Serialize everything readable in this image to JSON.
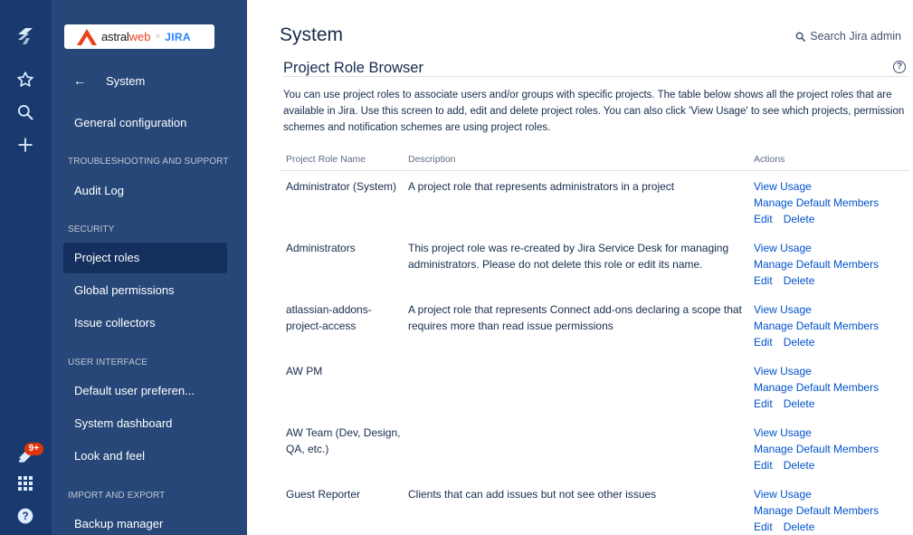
{
  "brand": {
    "part1": "astral",
    "part2": "web",
    "separator": "×",
    "product": "JIRA"
  },
  "sidebar": {
    "back_label": "System",
    "items": [
      {
        "label": "General configuration",
        "active": false
      },
      {
        "section": "TROUBLESHOOTING AND SUPPORT"
      },
      {
        "label": "Audit Log",
        "active": false
      },
      {
        "section": "SECURITY"
      },
      {
        "label": "Project roles",
        "active": true
      },
      {
        "label": "Global permissions",
        "active": false
      },
      {
        "label": "Issue collectors",
        "active": false
      },
      {
        "section": "USER INTERFACE"
      },
      {
        "label": "Default user preferen...",
        "active": false
      },
      {
        "label": "System dashboard",
        "active": false
      },
      {
        "label": "Look and feel",
        "active": false
      },
      {
        "section": "IMPORT AND EXPORT"
      },
      {
        "label": "Backup manager",
        "active": false
      }
    ]
  },
  "rail": {
    "notifications_badge": "9+"
  },
  "header": {
    "title": "System",
    "search_label": "Search Jira admin"
  },
  "content": {
    "section_title": "Project Role Browser",
    "help_label": "?",
    "intro": "You can use project roles to associate users and/or groups with specific projects. The table below shows all the project roles that are available in Jira. Use this screen to add, edit and delete project roles. You can also click 'View Usage' to see which projects, permission schemes and notification schemes are using project roles.",
    "columns": {
      "name": "Project Role Name",
      "description": "Description",
      "actions": "Actions"
    },
    "actions": {
      "view_usage": "View Usage",
      "manage": "Manage Default Members",
      "edit": "Edit",
      "delete": "Delete"
    },
    "rows": [
      {
        "name": "Administrator (System)",
        "description": "A project role that represents administrators in a project"
      },
      {
        "name": "Administrators",
        "description": "This project role was re-created by Jira Service Desk for managing administrators. Please do not delete this role or edit its name."
      },
      {
        "name": "atlassian-addons-project-access",
        "description": "A project role that represents Connect add-ons declaring a scope that requires more than read issue permissions"
      },
      {
        "name": "AW PM",
        "description": ""
      },
      {
        "name": "AW Team (Dev, Design, QA, etc.)",
        "description": ""
      },
      {
        "name": "Guest Reporter",
        "description": "Clients that can add issues but not see other issues"
      }
    ]
  },
  "colors": {
    "rail": "#183a6e",
    "sidebar": "#274778",
    "active": "#15305f",
    "link": "#0052cc",
    "text": "#172b4d"
  }
}
